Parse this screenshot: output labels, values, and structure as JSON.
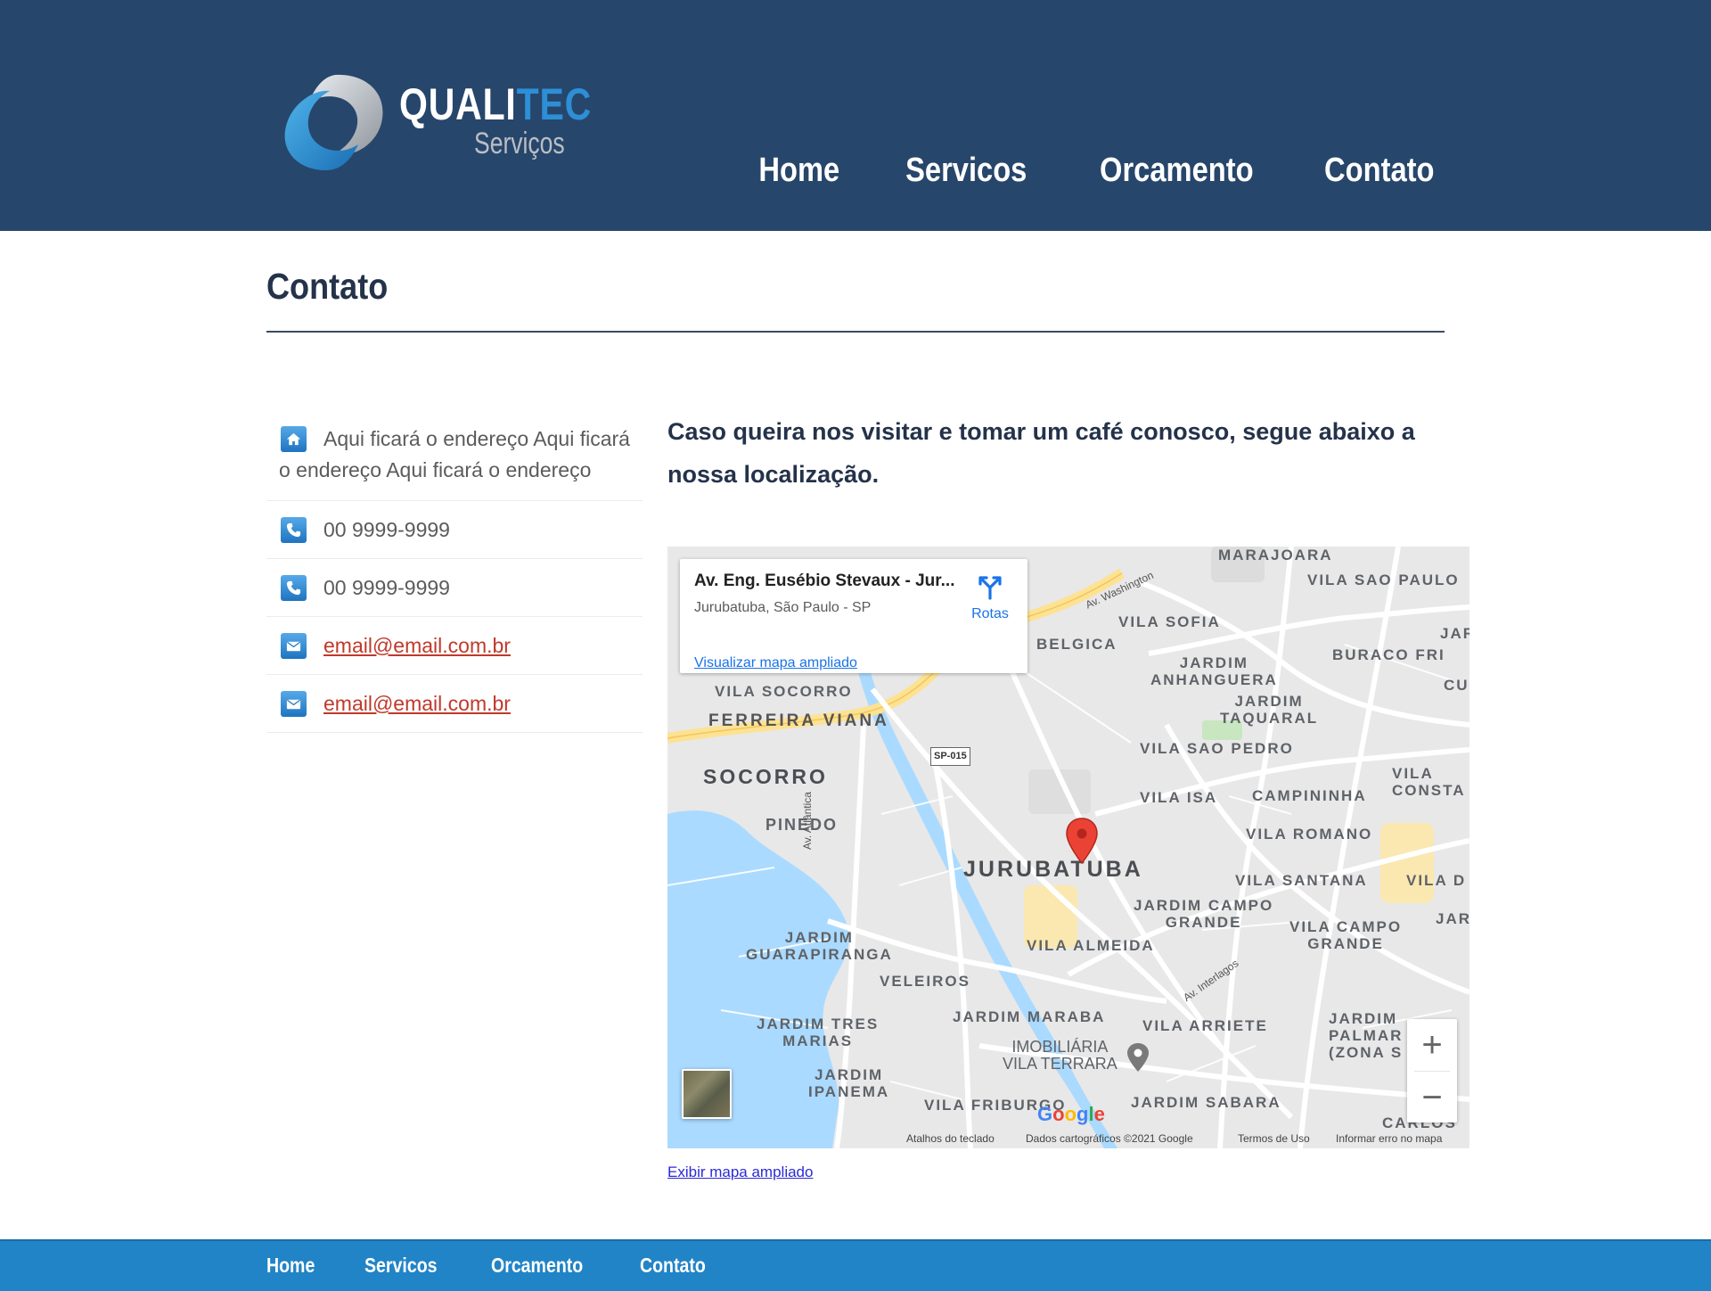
{
  "brand": {
    "name_part1": "QUALI",
    "name_part2": "TEC",
    "subtitle": "Serviços"
  },
  "nav": {
    "items": [
      {
        "label": "Home"
      },
      {
        "label": "Servicos"
      },
      {
        "label": "Orcamento"
      },
      {
        "label": "Contato"
      }
    ]
  },
  "page": {
    "title": "Contato",
    "intro": "Caso queira nos visitar e tomar um café conosco, segue abaixo a nossa localização."
  },
  "contact": {
    "address": {
      "icon": "home-icon",
      "text": "Aqui ficará o endereço Aqui ficará o endereço Aqui ficará o endereço"
    },
    "phone1": {
      "icon": "phone-icon",
      "text": "00 9999-9999"
    },
    "phone2": {
      "icon": "phone-icon",
      "text": "00 9999-9999"
    },
    "email1": {
      "icon": "mail-icon",
      "text": "email@email.com.br"
    },
    "email2": {
      "icon": "mail-icon",
      "text": "email@email.com.br"
    }
  },
  "map": {
    "place_title": "Av. Eng. Eusébio Stevaux - Jur...",
    "place_subtitle": "Jurubatuba, São Paulo - SP",
    "routes_label": "Rotas",
    "enlarge_link": "Visualizar mapa ampliado",
    "zoom_in": "+",
    "zoom_out": "−",
    "google": "Google",
    "attribution": {
      "shortcuts": "Atalhos do teclado",
      "data": "Dados cartográficos ©2021 Google",
      "terms": "Termos de Uso",
      "report": "Informar erro no mapa"
    },
    "labels": {
      "marajoara": "MARAJOARA",
      "vila_sao_paulo": "VILA SAO PAULO",
      "vila_sofia": "VILA SOFIA",
      "belgica": "BELGICA",
      "jardim_anhanguera": "JARDIM\nANHANGUERA",
      "buraco_fri": "BURACO FRI",
      "jar_top": "JAR",
      "cu": "CU",
      "jardim_taquaral": "JARDIM\nTAQUARAL",
      "vila_socorro": "VILA SOCORRO",
      "ferreira_viana": "FERREIRA VIANA",
      "sp015": "SP-015",
      "vila_sao_pedro": "VILA SAO PEDRO",
      "socorro": "SOCORRO",
      "vila_isa": "VILA ISA",
      "campininha": "CAMPININHA",
      "vila_consta": "VILA\nCONSTA",
      "pinedo": "PINEDO",
      "av_atlantica": "Av. Atlântica",
      "vila_romano": "VILA ROMANO",
      "jurubatuba": "JURUBATUBA",
      "vila_santana": "VILA SANTANA",
      "vila_d": "VILA D",
      "jardim_campo_grande": "JARDIM CAMPO\nGRANDE",
      "jar_mid": "JAR",
      "jardim_guarapiranga": "JARDIM\nGUARAPIRANGA",
      "vila_almeida": "VILA ALMEIDA",
      "vila_campo_grande": "VILA CAMPO\nGRANDE",
      "av_interlagos": "Av. Interlagos",
      "av_washington": "Av. Washington",
      "veleiros": "VELEIROS",
      "jardim_tres_marias": "JARDIM TRES\nMARIAS",
      "jardim_maraba": "JARDIM MARABA",
      "vila_arriete": "VILA ARRIETE",
      "jardim_palmares": "JARDIM\nPALMAR\n(ZONA S",
      "imobiliaria": "IMOBILIÁRIA\nVILA TERRARA",
      "jardim_ipanema": "JARDIM\nIPANEMA",
      "vila_friburgo": "VILA FRIBURGO",
      "jardim_sabara": "JARDIM SABARA",
      "carlos": "CARLOS"
    }
  },
  "map_link": "Exibir mapa ampliado",
  "footer": {
    "items": [
      {
        "label": "Home"
      },
      {
        "label": "Servicos"
      },
      {
        "label": "Orcamento"
      },
      {
        "label": "Contato"
      }
    ]
  },
  "colors": {
    "header_bg": "#27466b",
    "footer_bg": "#2184c7",
    "email": "#c0392b",
    "heading": "#24324a"
  }
}
